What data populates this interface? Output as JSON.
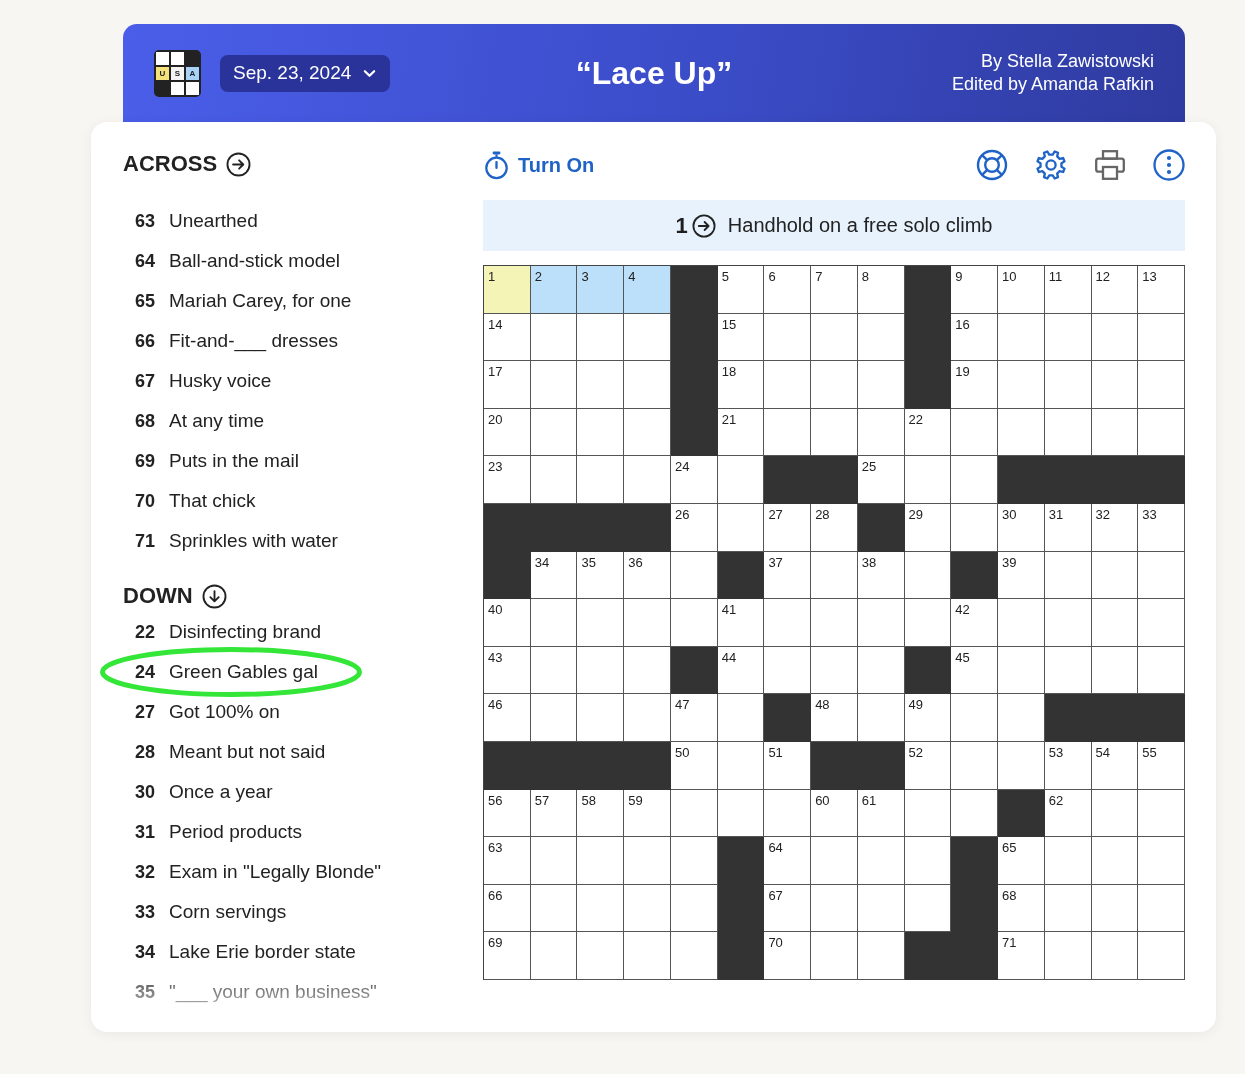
{
  "header": {
    "logo": {
      "letters": [
        "U",
        "S",
        "A"
      ]
    },
    "date": "Sep. 23, 2024",
    "title": "“Lace Up”",
    "byline": [
      "By Stella Zawistowski",
      "Edited by Amanda Rafkin"
    ]
  },
  "across": {
    "heading": "ACROSS",
    "clues": [
      {
        "number": "63",
        "text": "Unearthed",
        "circled": false
      },
      {
        "number": "64",
        "text": "Ball-and-stick model",
        "circled": false
      },
      {
        "number": "65",
        "text": "Mariah Carey, for one",
        "circled": false
      },
      {
        "number": "66",
        "text": "Fit-and-___ dresses",
        "circled": false
      },
      {
        "number": "67",
        "text": "Husky voice",
        "circled": false
      },
      {
        "number": "68",
        "text": "At any time",
        "circled": false
      },
      {
        "number": "69",
        "text": "Puts in the mail",
        "circled": false
      },
      {
        "number": "70",
        "text": "That chick",
        "circled": false
      },
      {
        "number": "71",
        "text": "Sprinkles with water",
        "circled": false
      }
    ]
  },
  "down": {
    "heading": "DOWN",
    "clues": [
      {
        "number": "22",
        "text": "Disinfecting brand",
        "circled": false
      },
      {
        "number": "24",
        "text": "Green Gables gal",
        "circled": true
      },
      {
        "number": "27",
        "text": "Got 100% on",
        "circled": false
      },
      {
        "number": "28",
        "text": "Meant but not said",
        "circled": false
      },
      {
        "number": "30",
        "text": "Once a year",
        "circled": false
      },
      {
        "number": "31",
        "text": "Period products",
        "circled": false
      },
      {
        "number": "32",
        "text": "Exam in \"Legally Blonde\"",
        "circled": false
      },
      {
        "number": "33",
        "text": "Corn servings",
        "circled": false
      },
      {
        "number": "34",
        "text": "Lake Erie border state",
        "circled": false
      },
      {
        "number": "35",
        "text": "\"___ your own business\"",
        "circled": false
      }
    ]
  },
  "toolbar": {
    "timer_label": "Turn On"
  },
  "active_clue": {
    "number": "1",
    "text": "Handhold on a free solo climb"
  },
  "grid": {
    "rows": [
      [
        {
          "kind": "open",
          "number": "1",
          "selected": true,
          "highlighted": false
        },
        {
          "kind": "open",
          "number": "2",
          "selected": false,
          "highlighted": true
        },
        {
          "kind": "open",
          "number": "3",
          "selected": false,
          "highlighted": true
        },
        {
          "kind": "open",
          "number": "4",
          "selected": false,
          "highlighted": true
        },
        {
          "kind": "block"
        },
        {
          "kind": "open",
          "number": "5",
          "selected": false,
          "highlighted": false
        },
        {
          "kind": "open",
          "number": "6",
          "selected": false,
          "highlighted": false
        },
        {
          "kind": "open",
          "number": "7",
          "selected": false,
          "highlighted": false
        },
        {
          "kind": "open",
          "number": "8",
          "selected": false,
          "highlighted": false
        },
        {
          "kind": "block"
        },
        {
          "kind": "open",
          "number": "9",
          "selected": false,
          "highlighted": false
        },
        {
          "kind": "open",
          "number": "10",
          "selected": false,
          "highlighted": false
        },
        {
          "kind": "open",
          "number": "11",
          "selected": false,
          "highlighted": false
        },
        {
          "kind": "open",
          "number": "12",
          "selected": false,
          "highlighted": false
        },
        {
          "kind": "open",
          "number": "13",
          "selected": false,
          "highlighted": false
        }
      ],
      [
        {
          "kind": "open",
          "number": "14",
          "selected": false,
          "highlighted": false
        },
        {
          "kind": "open",
          "selected": false,
          "highlighted": false
        },
        {
          "kind": "open",
          "selected": false,
          "highlighted": false
        },
        {
          "kind": "open",
          "selected": false,
          "highlighted": false
        },
        {
          "kind": "block"
        },
        {
          "kind": "open",
          "number": "15",
          "selected": false,
          "highlighted": false
        },
        {
          "kind": "open",
          "selected": false,
          "highlighted": false
        },
        {
          "kind": "open",
          "selected": false,
          "highlighted": false
        },
        {
          "kind": "open",
          "selected": false,
          "highlighted": false
        },
        {
          "kind": "block"
        },
        {
          "kind": "open",
          "number": "16",
          "selected": false,
          "highlighted": false
        },
        {
          "kind": "open",
          "selected": false,
          "highlighted": false
        },
        {
          "kind": "open",
          "selected": false,
          "highlighted": false
        },
        {
          "kind": "open",
          "selected": false,
          "highlighted": false
        },
        {
          "kind": "open",
          "selected": false,
          "highlighted": false
        }
      ],
      [
        {
          "kind": "open",
          "number": "17",
          "selected": false,
          "highlighted": false
        },
        {
          "kind": "open",
          "selected": false,
          "highlighted": false
        },
        {
          "kind": "open",
          "selected": false,
          "highlighted": false
        },
        {
          "kind": "open",
          "selected": false,
          "highlighted": false
        },
        {
          "kind": "block"
        },
        {
          "kind": "open",
          "number": "18",
          "selected": false,
          "highlighted": false
        },
        {
          "kind": "open",
          "selected": false,
          "highlighted": false
        },
        {
          "kind": "open",
          "selected": false,
          "highlighted": false
        },
        {
          "kind": "open",
          "selected": false,
          "highlighted": false
        },
        {
          "kind": "block"
        },
        {
          "kind": "open",
          "number": "19",
          "selected": false,
          "highlighted": false
        },
        {
          "kind": "open",
          "selected": false,
          "highlighted": false
        },
        {
          "kind": "open",
          "selected": false,
          "highlighted": false
        },
        {
          "kind": "open",
          "selected": false,
          "highlighted": false
        },
        {
          "kind": "open",
          "selected": false,
          "highlighted": false
        }
      ],
      [
        {
          "kind": "open",
          "number": "20",
          "selected": false,
          "highlighted": false
        },
        {
          "kind": "open",
          "selected": false,
          "highlighted": false
        },
        {
          "kind": "open",
          "selected": false,
          "highlighted": false
        },
        {
          "kind": "open",
          "selected": false,
          "highlighted": false
        },
        {
          "kind": "block"
        },
        {
          "kind": "open",
          "number": "21",
          "selected": false,
          "highlighted": false
        },
        {
          "kind": "open",
          "selected": false,
          "highlighted": false
        },
        {
          "kind": "open",
          "selected": false,
          "highlighted": false
        },
        {
          "kind": "open",
          "selected": false,
          "highlighted": false
        },
        {
          "kind": "open",
          "number": "22",
          "selected": false,
          "highlighted": false
        },
        {
          "kind": "open",
          "selected": false,
          "highlighted": false
        },
        {
          "kind": "open",
          "selected": false,
          "highlighted": false
        },
        {
          "kind": "open",
          "selected": false,
          "highlighted": false
        },
        {
          "kind": "open",
          "selected": false,
          "highlighted": false
        },
        {
          "kind": "open",
          "selected": false,
          "highlighted": false
        }
      ],
      [
        {
          "kind": "open",
          "number": "23",
          "selected": false,
          "highlighted": false
        },
        {
          "kind": "open",
          "selected": false,
          "highlighted": false
        },
        {
          "kind": "open",
          "selected": false,
          "highlighted": false
        },
        {
          "kind": "open",
          "selected": false,
          "highlighted": false
        },
        {
          "kind": "open",
          "number": "24",
          "selected": false,
          "highlighted": false
        },
        {
          "kind": "open",
          "selected": false,
          "highlighted": false
        },
        {
          "kind": "block"
        },
        {
          "kind": "block"
        },
        {
          "kind": "open",
          "number": "25",
          "selected": false,
          "highlighted": false
        },
        {
          "kind": "open",
          "selected": false,
          "highlighted": false
        },
        {
          "kind": "open",
          "selected": false,
          "highlighted": false
        },
        {
          "kind": "block"
        },
        {
          "kind": "block"
        },
        {
          "kind": "block"
        },
        {
          "kind": "block"
        }
      ],
      [
        {
          "kind": "block"
        },
        {
          "kind": "block"
        },
        {
          "kind": "block"
        },
        {
          "kind": "block"
        },
        {
          "kind": "open",
          "number": "26",
          "selected": false,
          "highlighted": false
        },
        {
          "kind": "open",
          "selected": false,
          "highlighted": false
        },
        {
          "kind": "open",
          "number": "27",
          "selected": false,
          "highlighted": false
        },
        {
          "kind": "open",
          "number": "28",
          "selected": false,
          "highlighted": false
        },
        {
          "kind": "block"
        },
        {
          "kind": "open",
          "number": "29",
          "selected": false,
          "highlighted": false
        },
        {
          "kind": "open",
          "selected": false,
          "highlighted": false
        },
        {
          "kind": "open",
          "number": "30",
          "selected": false,
          "highlighted": false
        },
        {
          "kind": "open",
          "number": "31",
          "selected": false,
          "highlighted": false
        },
        {
          "kind": "open",
          "number": "32",
          "selected": false,
          "highlighted": false
        },
        {
          "kind": "open",
          "number": "33",
          "selected": false,
          "highlighted": false
        }
      ],
      [
        {
          "kind": "block"
        },
        {
          "kind": "open",
          "number": "34",
          "selected": false,
          "highlighted": false
        },
        {
          "kind": "open",
          "number": "35",
          "selected": false,
          "highlighted": false
        },
        {
          "kind": "open",
          "number": "36",
          "selected": false,
          "highlighted": false
        },
        {
          "kind": "open",
          "selected": false,
          "highlighted": false
        },
        {
          "kind": "block"
        },
        {
          "kind": "open",
          "number": "37",
          "selected": false,
          "highlighted": false
        },
        {
          "kind": "open",
          "selected": false,
          "highlighted": false
        },
        {
          "kind": "open",
          "number": "38",
          "selected": false,
          "highlighted": false
        },
        {
          "kind": "open",
          "selected": false,
          "highlighted": false
        },
        {
          "kind": "block"
        },
        {
          "kind": "open",
          "number": "39",
          "selected": false,
          "highlighted": false
        },
        {
          "kind": "open",
          "selected": false,
          "highlighted": false
        },
        {
          "kind": "open",
          "selected": false,
          "highlighted": false
        },
        {
          "kind": "open",
          "selected": false,
          "highlighted": false
        }
      ],
      [
        {
          "kind": "open",
          "number": "40",
          "selected": false,
          "highlighted": false
        },
        {
          "kind": "open",
          "selected": false,
          "highlighted": false
        },
        {
          "kind": "open",
          "selected": false,
          "highlighted": false
        },
        {
          "kind": "open",
          "selected": false,
          "highlighted": false
        },
        {
          "kind": "open",
          "selected": false,
          "highlighted": false
        },
        {
          "kind": "open",
          "number": "41",
          "selected": false,
          "highlighted": false
        },
        {
          "kind": "open",
          "selected": false,
          "highlighted": false
        },
        {
          "kind": "open",
          "selected": false,
          "highlighted": false
        },
        {
          "kind": "open",
          "selected": false,
          "highlighted": false
        },
        {
          "kind": "open",
          "selected": false,
          "highlighted": false
        },
        {
          "kind": "open",
          "number": "42",
          "selected": false,
          "highlighted": false
        },
        {
          "kind": "open",
          "selected": false,
          "highlighted": false
        },
        {
          "kind": "open",
          "selected": false,
          "highlighted": false
        },
        {
          "kind": "open",
          "selected": false,
          "highlighted": false
        },
        {
          "kind": "open",
          "selected": false,
          "highlighted": false
        }
      ],
      [
        {
          "kind": "open",
          "number": "43",
          "selected": false,
          "highlighted": false
        },
        {
          "kind": "open",
          "selected": false,
          "highlighted": false
        },
        {
          "kind": "open",
          "selected": false,
          "highlighted": false
        },
        {
          "kind": "open",
          "selected": false,
          "highlighted": false
        },
        {
          "kind": "block"
        },
        {
          "kind": "open",
          "number": "44",
          "selected": false,
          "highlighted": false
        },
        {
          "kind": "open",
          "selected": false,
          "highlighted": false
        },
        {
          "kind": "open",
          "selected": false,
          "highlighted": false
        },
        {
          "kind": "open",
          "selected": false,
          "highlighted": false
        },
        {
          "kind": "block"
        },
        {
          "kind": "open",
          "number": "45",
          "selected": false,
          "highlighted": false
        },
        {
          "kind": "open",
          "selected": false,
          "highlighted": false
        },
        {
          "kind": "open",
          "selected": false,
          "highlighted": false
        },
        {
          "kind": "open",
          "selected": false,
          "highlighted": false
        },
        {
          "kind": "open",
          "selected": false,
          "highlighted": false
        }
      ],
      [
        {
          "kind": "open",
          "number": "46",
          "selected": false,
          "highlighted": false
        },
        {
          "kind": "open",
          "selected": false,
          "highlighted": false
        },
        {
          "kind": "open",
          "selected": false,
          "highlighted": false
        },
        {
          "kind": "open",
          "selected": false,
          "highlighted": false
        },
        {
          "kind": "open",
          "number": "47",
          "selected": false,
          "highlighted": false
        },
        {
          "kind": "open",
          "selected": false,
          "highlighted": false
        },
        {
          "kind": "block"
        },
        {
          "kind": "open",
          "number": "48",
          "selected": false,
          "highlighted": false
        },
        {
          "kind": "open",
          "selected": false,
          "highlighted": false
        },
        {
          "kind": "open",
          "number": "49",
          "selected": false,
          "highlighted": false
        },
        {
          "kind": "open",
          "selected": false,
          "highlighted": false
        },
        {
          "kind": "open",
          "selected": false,
          "highlighted": false
        },
        {
          "kind": "block"
        },
        {
          "kind": "block"
        },
        {
          "kind": "block"
        }
      ],
      [
        {
          "kind": "block"
        },
        {
          "kind": "block"
        },
        {
          "kind": "block"
        },
        {
          "kind": "block"
        },
        {
          "kind": "open",
          "number": "50",
          "selected": false,
          "highlighted": false
        },
        {
          "kind": "open",
          "selected": false,
          "highlighted": false
        },
        {
          "kind": "open",
          "number": "51",
          "selected": false,
          "highlighted": false
        },
        {
          "kind": "block"
        },
        {
          "kind": "block"
        },
        {
          "kind": "open",
          "number": "52",
          "selected": false,
          "highlighted": false
        },
        {
          "kind": "open",
          "selected": false,
          "highlighted": false
        },
        {
          "kind": "open",
          "selected": false,
          "highlighted": false
        },
        {
          "kind": "open",
          "number": "53",
          "selected": false,
          "highlighted": false
        },
        {
          "kind": "open",
          "number": "54",
          "selected": false,
          "highlighted": false
        },
        {
          "kind": "open",
          "number": "55",
          "selected": false,
          "highlighted": false
        }
      ],
      [
        {
          "kind": "open",
          "number": "56",
          "selected": false,
          "highlighted": false
        },
        {
          "kind": "open",
          "number": "57",
          "selected": false,
          "highlighted": false
        },
        {
          "kind": "open",
          "number": "58",
          "selected": false,
          "highlighted": false
        },
        {
          "kind": "open",
          "number": "59",
          "selected": false,
          "highlighted": false
        },
        {
          "kind": "open",
          "selected": false,
          "highlighted": false
        },
        {
          "kind": "open",
          "selected": false,
          "highlighted": false
        },
        {
          "kind": "open",
          "selected": false,
          "highlighted": false
        },
        {
          "kind": "open",
          "number": "60",
          "selected": false,
          "highlighted": false
        },
        {
          "kind": "open",
          "number": "61",
          "selected": false,
          "highlighted": false
        },
        {
          "kind": "open",
          "selected": false,
          "highlighted": false
        },
        {
          "kind": "open",
          "selected": false,
          "highlighted": false
        },
        {
          "kind": "block"
        },
        {
          "kind": "open",
          "number": "62",
          "selected": false,
          "highlighted": false
        },
        {
          "kind": "open",
          "selected": false,
          "highlighted": false
        },
        {
          "kind": "open",
          "selected": false,
          "highlighted": false
        }
      ],
      [
        {
          "kind": "open",
          "number": "63",
          "selected": false,
          "highlighted": false
        },
        {
          "kind": "open",
          "selected": false,
          "highlighted": false
        },
        {
          "kind": "open",
          "selected": false,
          "highlighted": false
        },
        {
          "kind": "open",
          "selected": false,
          "highlighted": false
        },
        {
          "kind": "open",
          "selected": false,
          "highlighted": false
        },
        {
          "kind": "block"
        },
        {
          "kind": "open",
          "number": "64",
          "selected": false,
          "highlighted": false
        },
        {
          "kind": "open",
          "selected": false,
          "highlighted": false
        },
        {
          "kind": "open",
          "selected": false,
          "highlighted": false
        },
        {
          "kind": "open",
          "selected": false,
          "highlighted": false
        },
        {
          "kind": "block"
        },
        {
          "kind": "open",
          "number": "65",
          "selected": false,
          "highlighted": false
        },
        {
          "kind": "open",
          "selected": false,
          "highlighted": false
        },
        {
          "kind": "open",
          "selected": false,
          "highlighted": false
        },
        {
          "kind": "open",
          "selected": false,
          "highlighted": false
        }
      ],
      [
        {
          "kind": "open",
          "number": "66",
          "selected": false,
          "highlighted": false
        },
        {
          "kind": "open",
          "selected": false,
          "highlighted": false
        },
        {
          "kind": "open",
          "selected": false,
          "highlighted": false
        },
        {
          "kind": "open",
          "selected": false,
          "highlighted": false
        },
        {
          "kind": "open",
          "selected": false,
          "highlighted": false
        },
        {
          "kind": "block"
        },
        {
          "kind": "open",
          "number": "67",
          "selected": false,
          "highlighted": false
        },
        {
          "kind": "open",
          "selected": false,
          "highlighted": false
        },
        {
          "kind": "open",
          "selected": false,
          "highlighted": false
        },
        {
          "kind": "open",
          "selected": false,
          "highlighted": false
        },
        {
          "kind": "block"
        },
        {
          "kind": "open",
          "number": "68",
          "selected": false,
          "highlighted": false
        },
        {
          "kind": "open",
          "selected": false,
          "highlighted": false
        },
        {
          "kind": "open",
          "selected": false,
          "highlighted": false
        },
        {
          "kind": "open",
          "selected": false,
          "highlighted": false
        }
      ],
      [
        {
          "kind": "open",
          "number": "69",
          "selected": false,
          "highlighted": false
        },
        {
          "kind": "open",
          "selected": false,
          "highlighted": false
        },
        {
          "kind": "open",
          "selected": false,
          "highlighted": false
        },
        {
          "kind": "open",
          "selected": false,
          "highlighted": false
        },
        {
          "kind": "open",
          "selected": false,
          "highlighted": false
        },
        {
          "kind": "block"
        },
        {
          "kind": "open",
          "number": "70",
          "selected": false,
          "highlighted": false
        },
        {
          "kind": "open",
          "selected": false,
          "highlighted": false
        },
        {
          "kind": "open",
          "selected": false,
          "highlighted": false
        },
        {
          "kind": "block"
        },
        {
          "kind": "block"
        },
        {
          "kind": "open",
          "number": "71",
          "selected": false,
          "highlighted": false
        },
        {
          "kind": "open",
          "selected": false,
          "highlighted": false
        },
        {
          "kind": "open",
          "selected": false,
          "highlighted": false
        },
        {
          "kind": "open",
          "selected": false,
          "highlighted": false
        }
      ]
    ]
  }
}
